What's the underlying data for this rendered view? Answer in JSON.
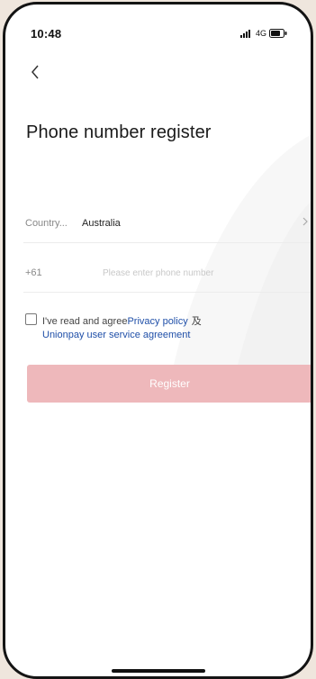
{
  "status_bar": {
    "time": "10:48",
    "network": "4G",
    "icons": [
      "signal-icon",
      "battery-icon"
    ]
  },
  "nav": {
    "back_icon": "chevron-left-icon"
  },
  "page": {
    "title": "Phone number register"
  },
  "form": {
    "country": {
      "label": "Country...",
      "value": "Australia",
      "icon": "chevron-right-icon"
    },
    "phone": {
      "prefix": "+61",
      "value": "",
      "placeholder": "Please enter phone number"
    },
    "agreement": {
      "checked": false,
      "text": "I've read and agree",
      "privacy_link": "Privacy policy",
      "conjunction": "及",
      "service_link": "Unionpay user service agreement"
    },
    "register_label": "Register"
  },
  "colors": {
    "link": "#1f4fa8",
    "register_button_disabled": "#eeb8bb",
    "background_frame": "#efe6dd"
  }
}
